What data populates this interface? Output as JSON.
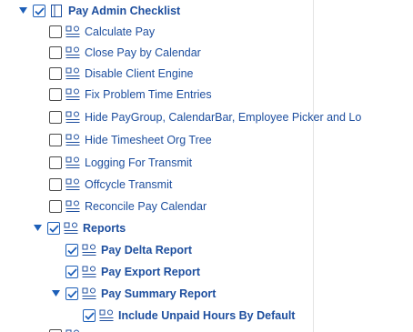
{
  "tree": {
    "root": {
      "label": "Pay Admin Checklist",
      "checked": true,
      "expanded": true
    },
    "items": [
      {
        "label": "Calculate Pay",
        "checked": false
      },
      {
        "label": "Close Pay by Calendar",
        "checked": false
      },
      {
        "label": "Disable Client Engine",
        "checked": false
      },
      {
        "label": "Fix Problem Time Entries",
        "checked": false
      },
      {
        "label": "Hide PayGroup, CalendarBar, Employee Picker and Lo",
        "checked": false
      },
      {
        "label": "Hide Timesheet Org Tree",
        "checked": false
      },
      {
        "label": "Logging For Transmit",
        "checked": false
      },
      {
        "label": "Offcycle Transmit",
        "checked": false
      },
      {
        "label": "Reconcile Pay Calendar",
        "checked": false
      }
    ],
    "reports": {
      "label": "Reports",
      "checked": true,
      "expanded": true,
      "children": [
        {
          "label": "Pay Delta Report",
          "checked": true
        },
        {
          "label": "Pay Export Report",
          "checked": true
        }
      ],
      "summary": {
        "label": "Pay Summary Report",
        "checked": true,
        "expanded": true,
        "children": [
          {
            "label": "Include Unpaid Hours By Default",
            "checked": true
          }
        ]
      }
    },
    "colors": {
      "text": "#1d4e9e",
      "check": "#1d5fb8",
      "toggle": "#1d5fb8"
    },
    "icons": {
      "book": "book-icon",
      "task": "task-icon",
      "check": "checkmark-icon",
      "expand": "expand-triangle-icon"
    }
  }
}
